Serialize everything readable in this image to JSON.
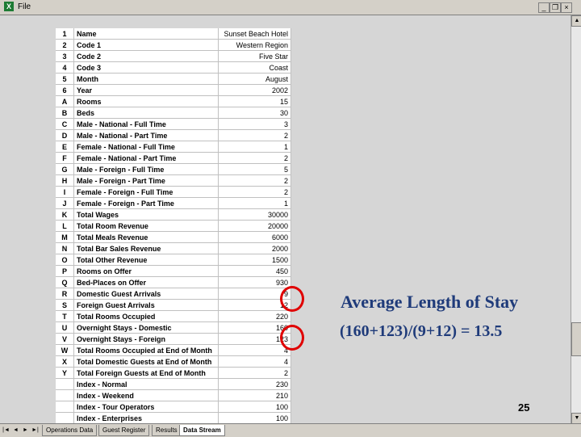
{
  "window": {
    "menu_file": "File",
    "minimize": "_",
    "restore": "❐",
    "close": "×"
  },
  "grid": {
    "rows": [
      {
        "code": "1",
        "label": "Name",
        "value": "Sunset Beach Hotel"
      },
      {
        "code": "2",
        "label": "Code 1",
        "value": "Western Region"
      },
      {
        "code": "3",
        "label": "Code 2",
        "value": "Five Star"
      },
      {
        "code": "4",
        "label": "Code 3",
        "value": "Coast"
      },
      {
        "code": "5",
        "label": "Month",
        "value": "August"
      },
      {
        "code": "6",
        "label": "Year",
        "value": "2002"
      },
      {
        "code": "A",
        "label": "Rooms",
        "value": "15"
      },
      {
        "code": "B",
        "label": "Beds",
        "value": "30"
      },
      {
        "code": "C",
        "label": "Male - National - Full Time",
        "value": "3"
      },
      {
        "code": "D",
        "label": "Male - National - Part Time",
        "value": "2"
      },
      {
        "code": "E",
        "label": "Female - National - Full Time",
        "value": "1"
      },
      {
        "code": "F",
        "label": "Female - National - Part Time",
        "value": "2"
      },
      {
        "code": "G",
        "label": "Male - Foreign - Full Time",
        "value": "5"
      },
      {
        "code": "H",
        "label": "Male - Foreign - Part Time",
        "value": "2"
      },
      {
        "code": "I",
        "label": "Female - Foreign - Full Time",
        "value": "2"
      },
      {
        "code": "J",
        "label": "Female - Foreign - Part Time",
        "value": "1"
      },
      {
        "code": "K",
        "label": "Total Wages",
        "value": "30000"
      },
      {
        "code": "L",
        "label": "Total Room Revenue",
        "value": "20000"
      },
      {
        "code": "M",
        "label": "Total Meals Revenue",
        "value": "6000"
      },
      {
        "code": "N",
        "label": "Total Bar Sales Revenue",
        "value": "2000"
      },
      {
        "code": "O",
        "label": "Total Other Revenue",
        "value": "1500"
      },
      {
        "code": "P",
        "label": "Rooms on Offer",
        "value": "450"
      },
      {
        "code": "Q",
        "label": "Bed-Places on Offer",
        "value": "930"
      },
      {
        "code": "R",
        "label": "Domestic Guest Arrivals",
        "value": "9"
      },
      {
        "code": "S",
        "label": "Foreign Guest Arrivals",
        "value": "12"
      },
      {
        "code": "T",
        "label": "Total Rooms Occupied",
        "value": "220"
      },
      {
        "code": "U",
        "label": "Overnight Stays - Domestic",
        "value": "160"
      },
      {
        "code": "V",
        "label": "Overnight Stays - Foreign",
        "value": "123"
      },
      {
        "code": "W",
        "label": "Total Rooms Occupied at End of Month",
        "value": "4"
      },
      {
        "code": "X",
        "label": "Total Domestic Guests at End of Month",
        "value": "4"
      },
      {
        "code": "Y",
        "label": "Total Foreign Guests at End of Month",
        "value": "2"
      },
      {
        "code": "",
        "label": "Index - Normal",
        "value": "230"
      },
      {
        "code": "",
        "label": "Index - Weekend",
        "value": "210"
      },
      {
        "code": "",
        "label": "Index - Tour Operators",
        "value": "100"
      },
      {
        "code": "",
        "label": "Index - Enterprises",
        "value": "100"
      }
    ]
  },
  "annotation": {
    "title": "Average Length of Stay",
    "formula": "(160+123)/(9+12) = 13.5",
    "color": "#1f3b7a",
    "circle_color": "#e00000"
  },
  "page_number": "25",
  "tabs": [
    {
      "label": "Operations Data",
      "active": false
    },
    {
      "label": "Guest Register",
      "active": false
    },
    {
      "label": "Results",
      "active": false
    },
    {
      "label": "Data Stream",
      "active": true
    }
  ]
}
